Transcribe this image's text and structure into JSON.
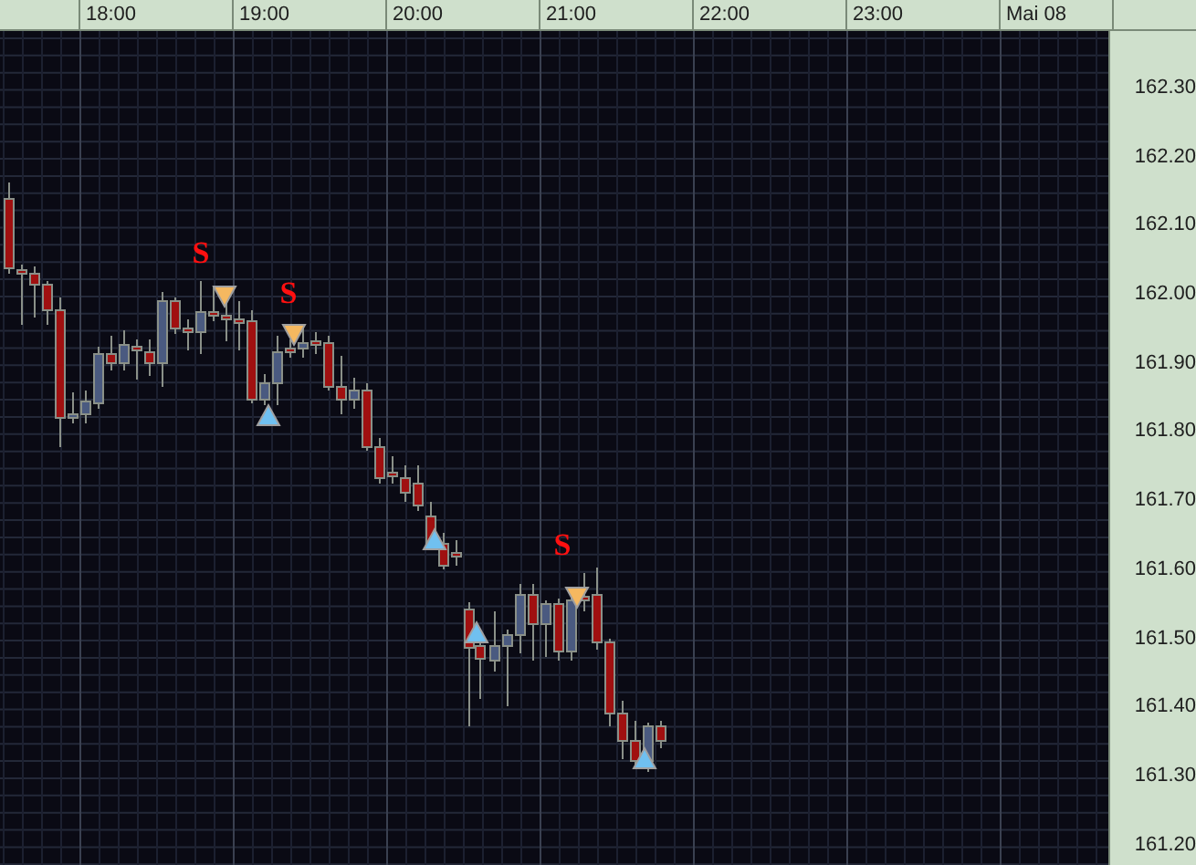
{
  "time_axis": {
    "labels": [
      "18:00",
      "19:00",
      "20:00",
      "21:00",
      "22:00",
      "23:00",
      "Mai 08"
    ]
  },
  "price_axis": {
    "labels": [
      "162.30",
      "162.20",
      "162.10",
      "162.00",
      "161.90",
      "161.80",
      "161.70",
      "161.60",
      "161.50",
      "161.40",
      "161.30",
      "161.20"
    ]
  },
  "signals": [
    {
      "kind": "label",
      "text": "S"
    },
    {
      "kind": "label",
      "text": "S"
    },
    {
      "kind": "label",
      "text": "S"
    },
    {
      "kind": "down"
    },
    {
      "kind": "down"
    },
    {
      "kind": "down"
    },
    {
      "kind": "up"
    },
    {
      "kind": "up"
    },
    {
      "kind": "up"
    },
    {
      "kind": "up"
    }
  ]
}
